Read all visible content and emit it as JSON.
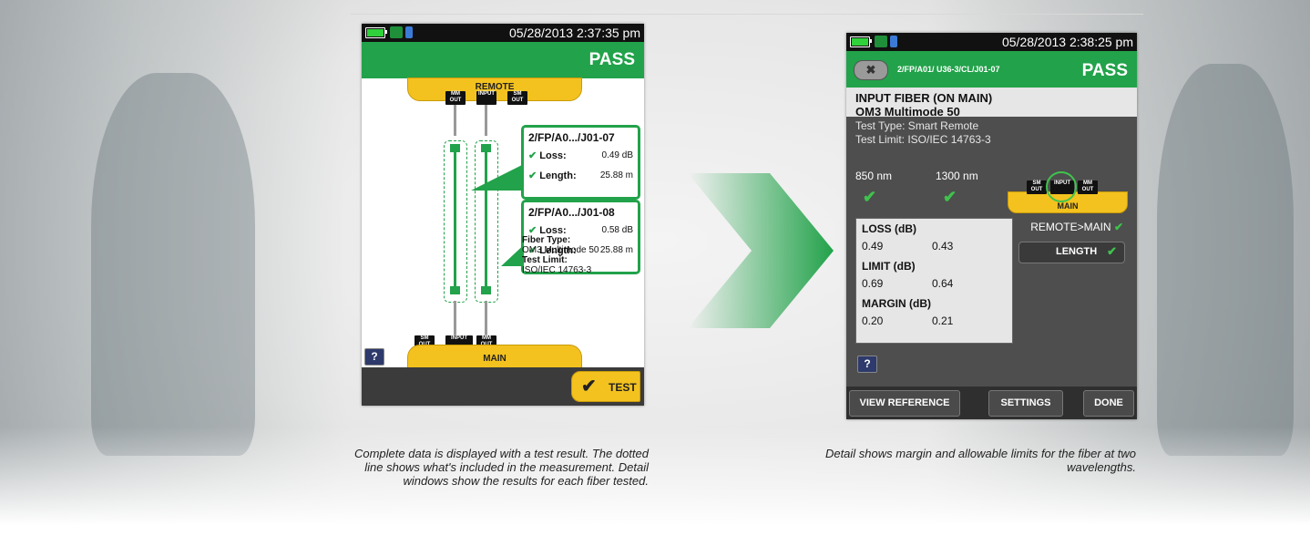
{
  "colors": {
    "accent_green": "#22a24a",
    "unit_yellow": "#f3c21f",
    "dark_gray": "#4e4e4e"
  },
  "screen1": {
    "datetime": "05/28/2013 2:37:35 pm",
    "result": "PASS",
    "remote_label": "REMOTE",
    "remote_ports": [
      "MM OUT",
      "INPUT",
      "SM OUT"
    ],
    "details": [
      {
        "title": "2/FP/A0.../J01-07",
        "loss_label": "Loss:",
        "loss_value": "0.49 dB",
        "length_label": "Length:",
        "length_value": "25.88 m"
      },
      {
        "title": "2/FP/A0.../J01-08",
        "loss_label": "Loss:",
        "loss_value": "0.58 dB",
        "length_label": "Length:",
        "length_value": "25.88 m"
      }
    ],
    "fiber_type_label": "Fiber Type:",
    "fiber_type_value": "OM3 Multimode 50",
    "test_limit_label": "Test Limit:",
    "test_limit_value": "ISO/IEC 14763-3",
    "main_label": "MAIN",
    "main_ports": [
      "SM OUT",
      "INPUT",
      "MM OUT"
    ],
    "help_label": "?",
    "test_button": "TEST",
    "check_glyph": "✔"
  },
  "screen2": {
    "datetime": "05/28/2013 2:38:25 pm",
    "back_glyph": "✖",
    "path": "2/FP/A01/ U36-3/CL/J01-07",
    "result": "PASS",
    "header_line1": "INPUT FIBER (ON MAIN)",
    "header_line2": "OM3 Multimode 50",
    "test_type": "Test Type: Smart Remote",
    "test_limit": "Test Limit: ISO/IEC 14763-3",
    "wl1": "850 nm",
    "wl2": "1300 nm",
    "unit_label": "MAIN",
    "unit_ports": [
      "SM OUT",
      "INPUT",
      "MM OUT"
    ],
    "loss_header": "LOSS (dB)",
    "loss_values": [
      "0.49",
      "0.43"
    ],
    "limit_header": "LIMIT (dB)",
    "limit_values": [
      "0.69",
      "0.64"
    ],
    "margin_header": "MARGIN (dB)",
    "margin_values": [
      "0.20",
      "0.21"
    ],
    "direction": "REMOTE>MAIN",
    "length_button": "LENGTH",
    "help_label": "?",
    "footer_buttons": [
      "VIEW REFERENCE",
      "SETTINGS",
      "DONE"
    ],
    "check_glyph": "✔"
  },
  "captions": {
    "left": "Complete data is displayed with a test result. The dotted line shows what's included in the measurement. Detail windows show the results for each fiber tested.",
    "right": "Detail shows margin and allowable limits for the fiber at two wavelengths."
  }
}
